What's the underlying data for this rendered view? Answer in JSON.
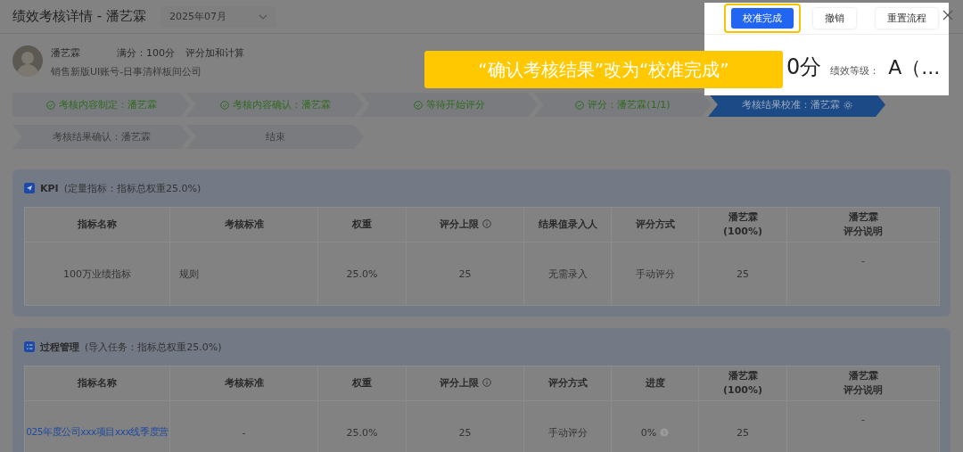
{
  "page": {
    "title": "绩效考核详情 - 潘艺霖",
    "month_select": {
      "value": "2025年07月"
    }
  },
  "profile": {
    "name": "潘艺霖",
    "full_score": "满分：100分",
    "method": "评分加和计算",
    "org": "销售新版UI账号-日事清样板间公司"
  },
  "steps": [
    {
      "label": "考核内容制定：潘艺霖",
      "done": true,
      "current": false
    },
    {
      "label": "考核内容确认：潘艺霖",
      "done": true,
      "current": false
    },
    {
      "label": "等待开始评分",
      "done": true,
      "current": false
    },
    {
      "label": "评分：潘艺霖(1/1)",
      "done": true,
      "current": false
    },
    {
      "label": "考核结果校准：潘艺霖",
      "done": false,
      "current": true
    },
    {
      "label": "考核结果确认：潘艺霖",
      "done": false,
      "current": false
    },
    {
      "label": "结束",
      "done": false,
      "current": false
    }
  ],
  "sections": [
    {
      "kind": "kpi",
      "title": "KPI",
      "note": "(定量指标：指标总权重25.0%)",
      "columns": [
        {
          "lines": [
            "指标名称"
          ]
        },
        {
          "lines": [
            "考核标准"
          ]
        },
        {
          "lines": [
            "权重"
          ]
        },
        {
          "lines": [
            "评分上限"
          ],
          "info": true
        },
        {
          "lines": [
            "结果值录入人"
          ]
        },
        {
          "lines": [
            "评分方式"
          ]
        },
        {
          "lines": [
            "潘艺霖",
            "(100%)"
          ]
        },
        {
          "lines": [
            "潘艺霖",
            "评分说明"
          ]
        }
      ],
      "rows": [
        [
          {
            "text": "100万业绩指标"
          },
          {
            "text": "规则",
            "left": true
          },
          {
            "text": "25.0%"
          },
          {
            "text": "25"
          },
          {
            "text": "无需录入"
          },
          {
            "text": "手动评分"
          },
          {
            "text": "25"
          },
          {
            "text": "-"
          }
        ]
      ]
    },
    {
      "kind": "process",
      "title": "过程管理",
      "note": "(导入任务：指标总权重25.0%)",
      "columns": [
        {
          "lines": [
            "指标名称"
          ]
        },
        {
          "lines": [
            "考核标准"
          ]
        },
        {
          "lines": [
            "权重"
          ]
        },
        {
          "lines": [
            "评分上限"
          ],
          "info": true
        },
        {
          "lines": [
            "评分方式"
          ]
        },
        {
          "lines": [
            "进度"
          ]
        },
        {
          "lines": [
            "潘艺霖",
            "(100%)"
          ]
        },
        {
          "lines": [
            "潘艺霖",
            "评分说明"
          ]
        }
      ],
      "rows": [
        [
          {
            "text": "025年度公司xxx项目xxx线季度营",
            "kind": "link"
          },
          {
            "text": "-"
          },
          {
            "text": "25.0%"
          },
          {
            "text": "25"
          },
          {
            "text": "手动评分"
          },
          {
            "text": "0%",
            "info": true
          },
          {
            "text": "25"
          },
          {
            "text": "-"
          }
        ]
      ]
    }
  ],
  "popup": {
    "buttons": [
      {
        "label": "校准完成",
        "primary": true,
        "highlighted": true
      },
      {
        "label": "撤销",
        "primary": false,
        "highlighted": false
      },
      {
        "label": "重置流程",
        "primary": false,
        "highlighted": false
      }
    ],
    "score": "0分",
    "grade_label": "绩效等级：",
    "grade": "A（..."
  },
  "callout": {
    "text": "“确认考核结果”改为“校准完成”"
  }
}
